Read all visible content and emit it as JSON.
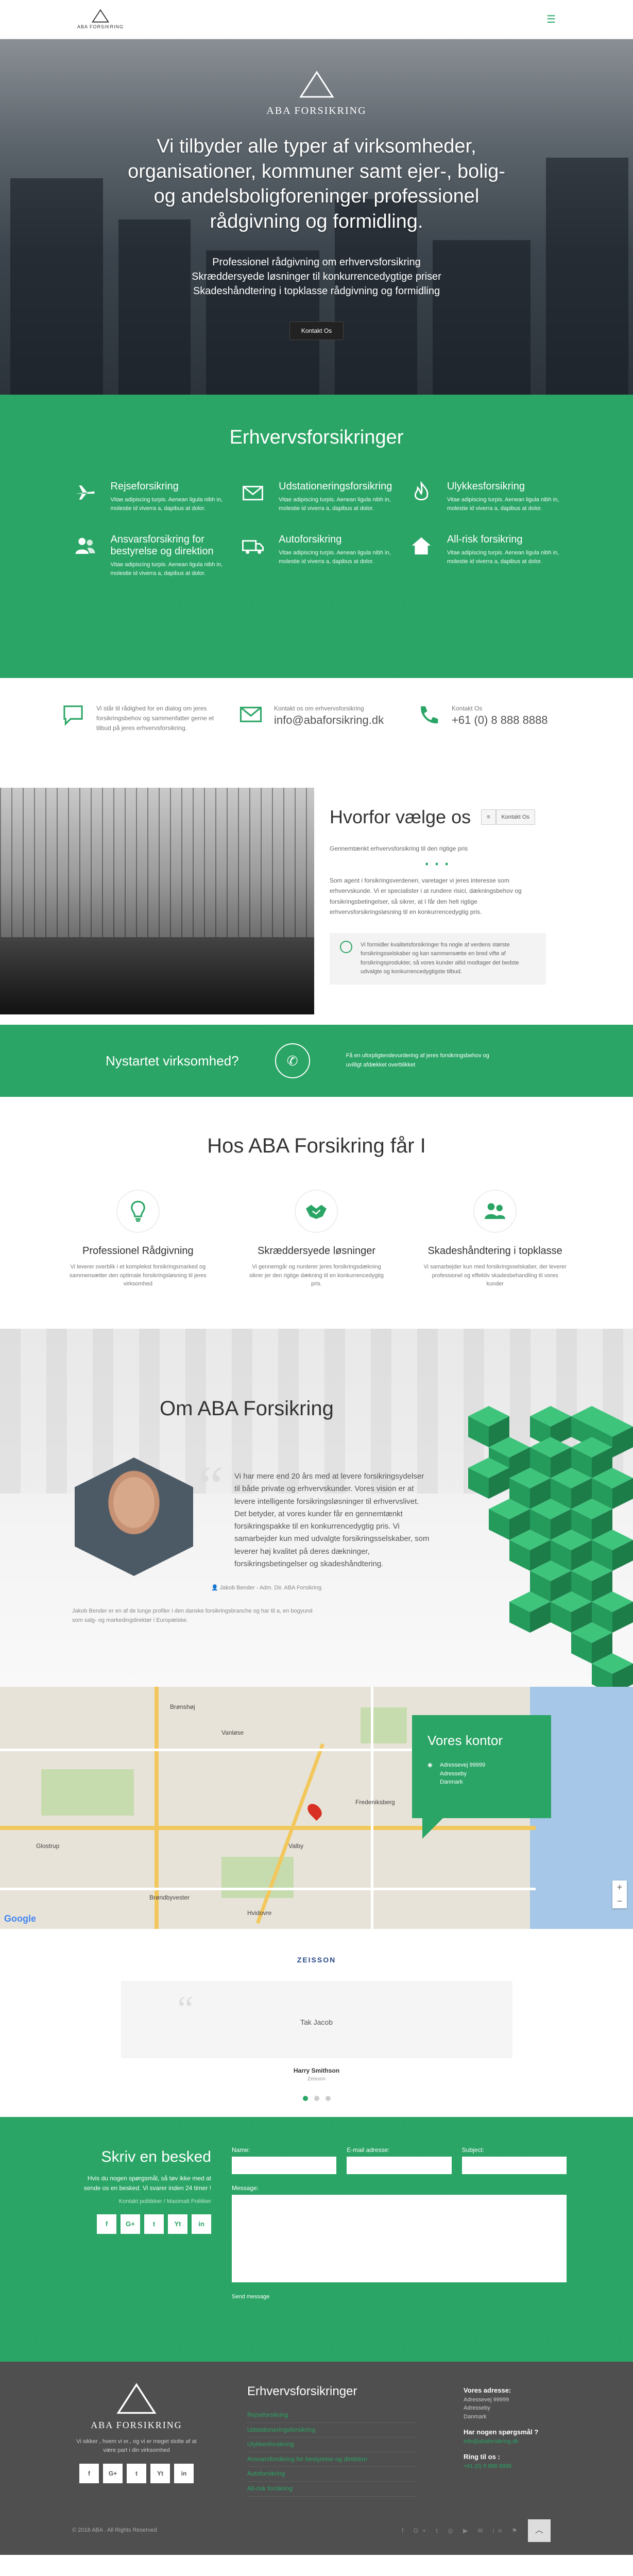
{
  "header": {
    "logo_text": "ABA FORSIKRING",
    "menu_icon": "hamburger-icon"
  },
  "hero": {
    "logo_text": "ABA FORSIKRING",
    "title": "Vi tilbyder alle typer af virksomheder, organisationer, kommuner samt ejer-, bolig- og andelsboligforeninger professionel rådgivning og formidling.",
    "lines": [
      "Professionel rådgivning om erhvervsforsikring",
      "Skræddersyede løsninger til konkurrencedygtige priser",
      "Skadeshåndtering i topklasse rådgivning og formidling"
    ],
    "cta": "Kontakt Os"
  },
  "services": {
    "title": "Erhvervsforsikringer",
    "items": [
      {
        "title": "Rejseforsikring",
        "text": "Vitae adipiscing turpis. Aenean ligula nibh in, molestie id viverra a, dapibus at dolor.",
        "icon": "airplane-icon"
      },
      {
        "title": "Udstationeringsforsikring",
        "text": "Vitae adipiscing turpis. Aenean ligula nibh in, molestie id viverra a, dapibus at dolor.",
        "icon": "envelope-icon"
      },
      {
        "title": "Ulykkesforsikring",
        "text": "Vitae adipiscing turpis. Aenean ligula nibh in, molestie id viverra a, dapibus at dolor.",
        "icon": "fire-icon"
      },
      {
        "title": "Ansvarsforsikring for bestyrelse og direktion",
        "text": "Vitae adipiscing turpis. Aenean ligula nibh in, molestie id viverra a, dapibus at dolor.",
        "icon": "users-icon"
      },
      {
        "title": "Autoforsikring",
        "text": "Vitae adipiscing turpis. Aenean ligula nibh in, molestie id viverra a, dapibus at dolor.",
        "icon": "truck-icon"
      },
      {
        "title": "All-risk forsikring",
        "text": "Vitae adipiscing turpis. Aenean ligula nibh in, molestie id viverra a, dapibus at dolor.",
        "icon": "home-icon"
      }
    ]
  },
  "contact_strip": {
    "items": [
      {
        "icon": "chat-icon",
        "text": "Vi står til rådighed for en dialog om jeres forsikringsbehov og sammenfatter gerne et tilbud på jeres erhvervsforsikring.",
        "big": ""
      },
      {
        "icon": "envelope-icon",
        "text": "Kontakt os om erhvervsforsikring",
        "big": "info@abaforsikring.dk"
      },
      {
        "icon": "phone-icon",
        "text": "Kontakt Os",
        "big": "+61 (0) 8 888 8888"
      }
    ]
  },
  "why": {
    "title": "Hvorfor vælge os",
    "btn": "Kontakt Os",
    "lead": "Gennemtænkt erhvervsforsikring til den rigtige pris",
    "body": "Som agent i forsikringsverdenen, varetager vi jeres interesse som erhvervskunde. Vi er specialister i at rundere risici, dækningsbehov og forsikringsbetingelser, så sikrer, at I får den helt rigtige erhvervsforsikringsløsning til en konkurrencedygtig pris.",
    "quote": "Vi formidler kvalitetsforsikringer fra nogle af verdens største forsikringsselskaber og kan sammensætte en bred vifte af forsikringsprodukter, så vores kunder altid modtager det bedste udvalgte og konkurrencedygtigste tilbud."
  },
  "startup": {
    "title": "Nystartet virksomhed?",
    "text": "Få en uforpligtendevurdering af jeres forsikringsbehov og uvilligt afdækket overblikket"
  },
  "hos": {
    "title": "Hos ABA Forsikring får I",
    "items": [
      {
        "icon": "lightbulb-icon",
        "title": "Professionel Rådgivning",
        "text": "Vi leverer overblik i et komplekst forsikringsmarked og sammensætter den optimale forsikringsløsning til jeres virksomhed"
      },
      {
        "icon": "handshake-icon",
        "title": "Skræddersyede løsninger",
        "text": "Vi gennemgår og nurderer jeres forsikringsdækning sikrer jer den rigtige dækning til en konkurrencedygtig pris."
      },
      {
        "icon": "people-icon",
        "title": "Skadeshåndtering i topklasse",
        "text": "Vi samarbejder kun med forsikringsselskaber, der leverer professionel og effektiv skadesbehandling til vores kunder"
      }
    ]
  },
  "om": {
    "title": "Om ABA Forsikring",
    "quote": "Vi har mere end 20 års med at levere forsikringsydelser til både private og erhvervskunder. Vores vision er at levere intelligente forsikringsløsninger til erhvervslivet. Det betyder, at vores kunder får en gennemtænkt forsikringspakke til en konkurrencedygtig pris. Vi samarbejder kun med udvalgte forsikringsselskaber, som leverer høj kvalitet på deres dækninger, forsikringsbetingelser og skadeshåndtering.",
    "sig": "Jakob Bender - Adm. Dir. ABA Forsikring",
    "bottom": "Jakob Bender er en af de lunge profiler i den danske forsikringsbranche og har til a, en bogyund som salg- og markedingdirektør i Europæiske."
  },
  "map": {
    "box_title": "Vores kontor",
    "address": "Adressevej 99999\nAdresseby\nDanmark",
    "labels": [
      "Fredeniksberg",
      "Brøndbyvester",
      "Glostrup",
      "Hvidovre",
      "Valby",
      "Vanløse",
      "Brønshøj"
    ],
    "google": "Google"
  },
  "testimonial": {
    "logo": "ZEISSON",
    "text": "Tak Jacob",
    "name": "Harry Smithson",
    "role": "Zeisson"
  },
  "form": {
    "title": "Skriv en besked",
    "text": "Hvis du nogen spørgsmål, så tøv ikke med at sende os en besked. Vi svarer inden 24 timer !",
    "link": "Kontakt politikker / Maximalt Politiker",
    "social": [
      "f",
      "G+",
      "t",
      "Yt",
      "in"
    ],
    "name_label": "Name:",
    "email_label": "E-mail adresse:",
    "subject_label": "Subject:",
    "message_label": "Message:",
    "send": "Send message"
  },
  "footer": {
    "logo_text": "ABA FORSIKRING",
    "tagline": "Vi sikker , hvem vi er., og vi er meget stolte af at være part i din virksomhed",
    "social": [
      "f",
      "G+",
      "t",
      "Yt",
      "in"
    ],
    "menu_title": "Erhvervsforsikringer",
    "menu": [
      "Rejseforsikring",
      "Udstationeringsforsikring",
      "Ulykkesforsikring",
      "Ansvarsforsikring for bestyrelse og direktion",
      "Autoforsikring",
      "All-risk forsikring"
    ],
    "address_title": "Vores adresse:",
    "address": "Adressevej 99999\nAdresseby\nDanmark",
    "q_title": "Har nogen spørgsmål ?",
    "q_value": "info@abaforsikring.dk",
    "ring_title": "Ring til os :",
    "ring_value": "+61 (0) 8 888 8888",
    "copy": "© 2018 ABA . All Rights Reserved"
  }
}
